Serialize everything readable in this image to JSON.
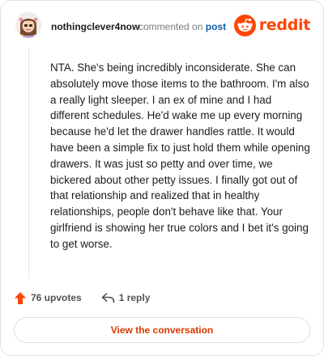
{
  "header": {
    "username": "nothingclever4now",
    "action_text": "commented on",
    "post_link": "post",
    "brand": "reddit"
  },
  "comment": {
    "text": "NTA. She's being incredibly inconsiderate. She can absolutely move those items to the bathroom. I'm also a really light sleeper. I an ex of mine and I had different schedules. He'd wake me up every morning because he'd let the drawer handles rattle. It would have been a simple fix to just hold them while opening drawers. It was just so petty and over time, we bickered about other petty issues. I finally got out of that relationship and realized that in healthy relationships, people don't behave like that. Your girlfriend is showing her true colors and I bet it's going to get worse."
  },
  "actions": {
    "upvotes": "76 upvotes",
    "replies": "1 reply"
  },
  "cta": {
    "label": "View the conversation"
  },
  "colors": {
    "brand": "#ff4500",
    "link": "#0d5fa8",
    "cta_text": "#d93a00"
  },
  "icons": {
    "avatar": "avatar",
    "brand": "reddit-logo-icon",
    "upvote": "upvote-arrow-icon",
    "reply": "reply-arrow-icon"
  }
}
